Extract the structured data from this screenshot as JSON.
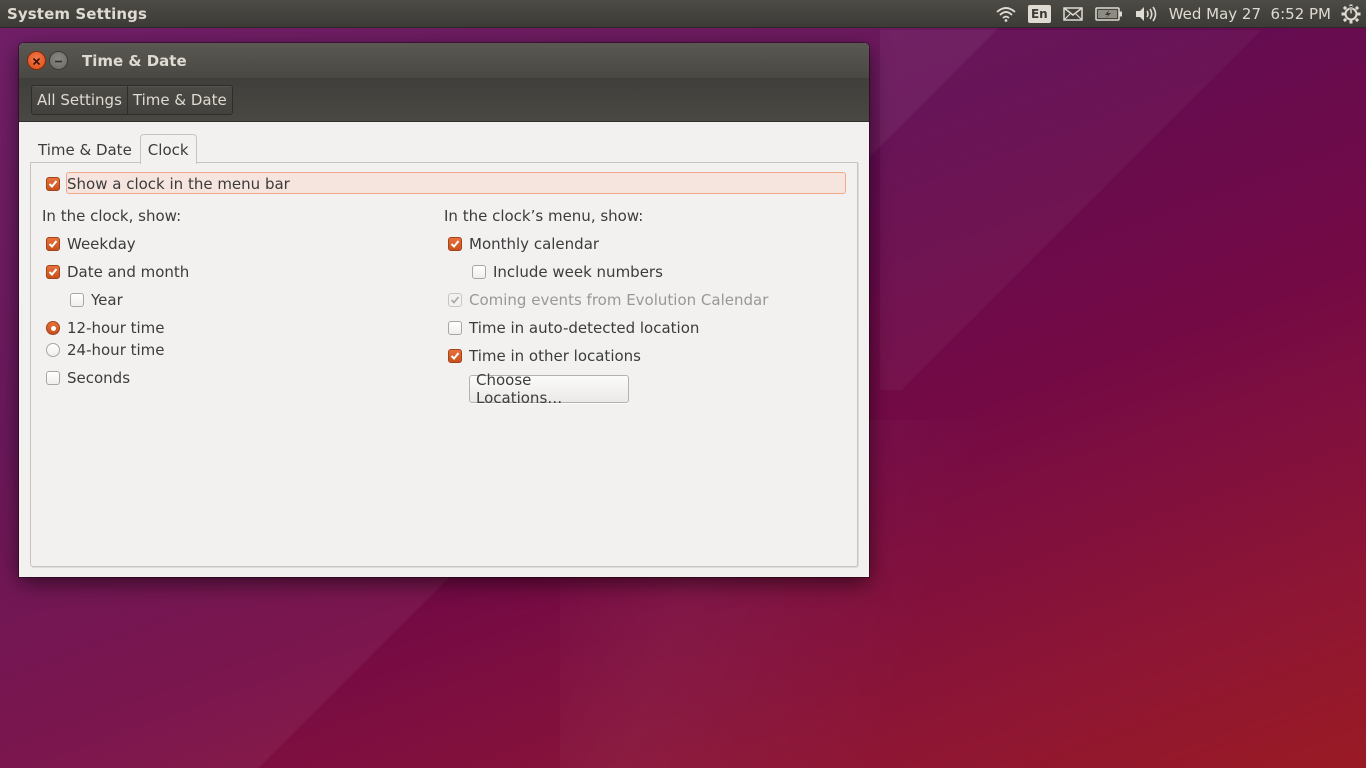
{
  "top_panel": {
    "app_title": "System Settings",
    "indicators": {
      "network_icon": "wifi-icon",
      "keyboard_layout": "En",
      "messaging_icon": "envelope-icon",
      "battery_icon": "battery-charging-icon",
      "sound_icon": "speaker-icon",
      "datetime": "Wed May 27  6:52 PM",
      "session_icon": "power-gear-icon"
    }
  },
  "window": {
    "title": "Time & Date",
    "buttons": {
      "close": "close-icon",
      "minimize": "minimize-icon"
    },
    "breadcrumb": [
      {
        "label": "All Settings"
      },
      {
        "label": "Time & Date"
      }
    ],
    "tabs": [
      {
        "label": "Time & Date",
        "active": false
      },
      {
        "label": "Clock",
        "active": true
      }
    ],
    "clock_tab": {
      "show_clock": {
        "label": "Show a clock in the menu bar",
        "checked": true
      },
      "left_heading": "In the clock, show:",
      "left_options": {
        "weekday": {
          "label": "Weekday",
          "checked": true
        },
        "date_month": {
          "label": "Date and month",
          "checked": true
        },
        "year": {
          "label": "Year",
          "checked": false
        },
        "hour12": {
          "label": "12-hour time",
          "selected": true
        },
        "hour24": {
          "label": "24-hour time",
          "selected": false
        },
        "seconds": {
          "label": "Seconds",
          "checked": false
        }
      },
      "right_heading": "In the clock’s menu, show:",
      "right_options": {
        "monthly_calendar": {
          "label": "Monthly calendar",
          "checked": true
        },
        "week_numbers": {
          "label": "Include week numbers",
          "checked": false
        },
        "coming_events": {
          "label": "Coming events from Evolution Calendar",
          "checked": true,
          "disabled": true
        },
        "auto_location": {
          "label": "Time in auto-detected location",
          "checked": false
        },
        "other_locations": {
          "label": "Time in other locations",
          "checked": true
        }
      },
      "choose_locations_button": "Choose Locations…"
    }
  },
  "colors": {
    "accent": "#dd4814",
    "panel": "#3c3b37",
    "window_bg": "#f2f1f0",
    "focus_bg": "#f6e4de",
    "focus_border": "#efa98a"
  }
}
